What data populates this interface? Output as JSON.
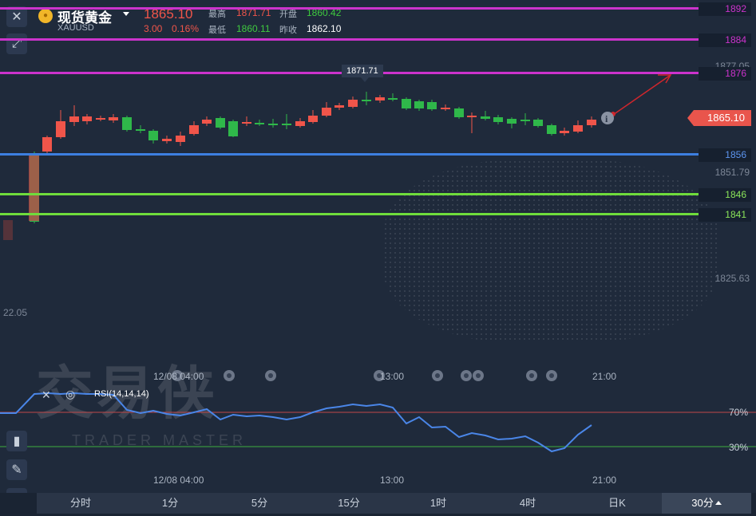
{
  "header": {
    "symbol_name": "现货黄金",
    "symbol_code": "XAUUSD",
    "last_price": "1865.10",
    "change": "3.00",
    "change_pct": "0.16%",
    "high_label": "最高",
    "high": "1871.71",
    "open_label": "开盘",
    "open": "1860.42",
    "low_label": "最低",
    "low": "1860.11",
    "prev_close_label": "昨收",
    "prev_close": "1862.10"
  },
  "price_levels": [
    {
      "value": "1892",
      "color": "#cc33cc"
    },
    {
      "value": "1884",
      "color": "#cc33cc"
    },
    {
      "value": "1876",
      "color": "#cc33cc"
    },
    {
      "value": "1856",
      "color": "#3d7fe0"
    },
    {
      "value": "1846",
      "color": "#6fdc3c"
    },
    {
      "value": "1841",
      "color": "#6fdc3c"
    }
  ],
  "axis_labels": {
    "a": "1877.05",
    "b": "1851.79",
    "c": "1825.63",
    "d": "22.05"
  },
  "current_price_tag": "1865.10",
  "peak_label": "1871.71",
  "time_labels": {
    "t1": "12/08 04:00",
    "t2": "13:00",
    "t3": "21:00"
  },
  "rsi": {
    "label": "RSI(14,14,14)",
    "upper": "70%",
    "lower": "30%"
  },
  "watermark": {
    "title": "交易侠",
    "subtitle": "TRADER MASTER"
  },
  "timeframes": [
    "分时",
    "1分",
    "5分",
    "15分",
    "1时",
    "4时",
    "日K"
  ],
  "active_timeframe": "30分",
  "colors": {
    "up": "#f0554a",
    "down": "#2fb84a",
    "background": "#1f2a3b"
  },
  "icons": [
    "close-icon",
    "expand-icon",
    "info-icon",
    "indicator-icon",
    "pen-icon",
    "line-chart-icon"
  ]
}
